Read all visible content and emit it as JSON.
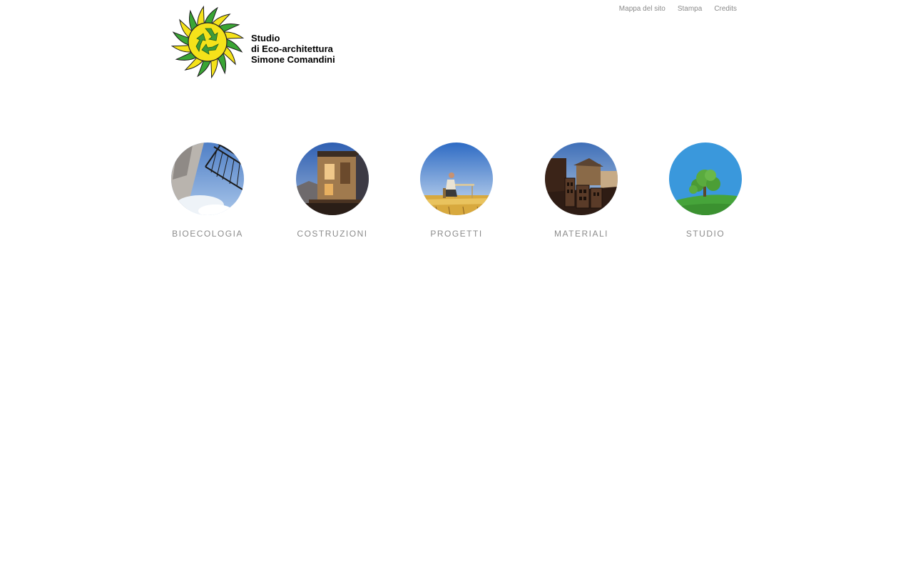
{
  "brand": {
    "logo_icon": "recycling-sun-logo",
    "line1": "Studio",
    "line2": "di Eco-architettura",
    "line3": "Simone Comandini",
    "colors": {
      "sun_yellow": "#f5e21a",
      "leaf_green": "#3aa535",
      "arrow_green": "#3f9b3a"
    }
  },
  "top_links": [
    {
      "label": "Mappa del sito"
    },
    {
      "label": "Stampa"
    },
    {
      "label": "Credits"
    }
  ],
  "nav": [
    {
      "label": "BIOECOLOGIA",
      "image": "windmill-photo"
    },
    {
      "label": "COSTRUZIONI",
      "image": "wooden-house-photo"
    },
    {
      "label": "PROGETTI",
      "image": "desk-in-field-photo"
    },
    {
      "label": "MATERIALI",
      "image": "bricks-photo"
    },
    {
      "label": "STUDIO",
      "image": "tree-on-hill-photo"
    }
  ],
  "colors": {
    "link_gray": "#8a8a8a",
    "label_gray": "#8c8c8c",
    "background": "#ffffff"
  }
}
